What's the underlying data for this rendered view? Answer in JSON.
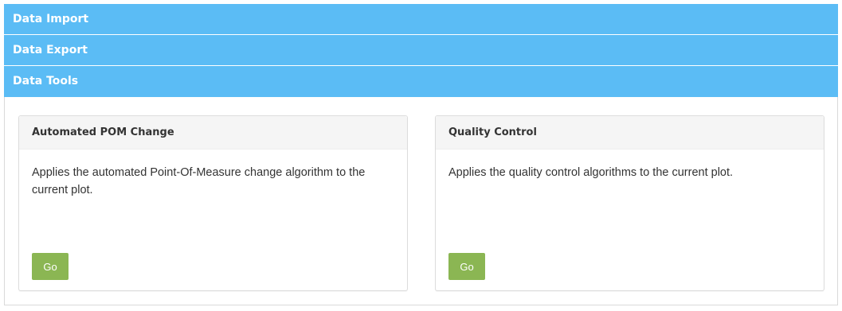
{
  "accordion": {
    "sections": [
      {
        "label": "Data Import"
      },
      {
        "label": "Data Export"
      },
      {
        "label": "Data Tools"
      }
    ]
  },
  "tools": {
    "panels": [
      {
        "title": "Automated POM Change",
        "description": "Applies the automated Point-Of-Measure change algorithm to the current plot.",
        "button_label": "Go"
      },
      {
        "title": "Quality Control",
        "description": "Applies the quality control algorithms to the current plot.",
        "button_label": "Go"
      }
    ]
  },
  "colors": {
    "header_accent": "#5bbcf5",
    "button_green": "#8bb653"
  }
}
